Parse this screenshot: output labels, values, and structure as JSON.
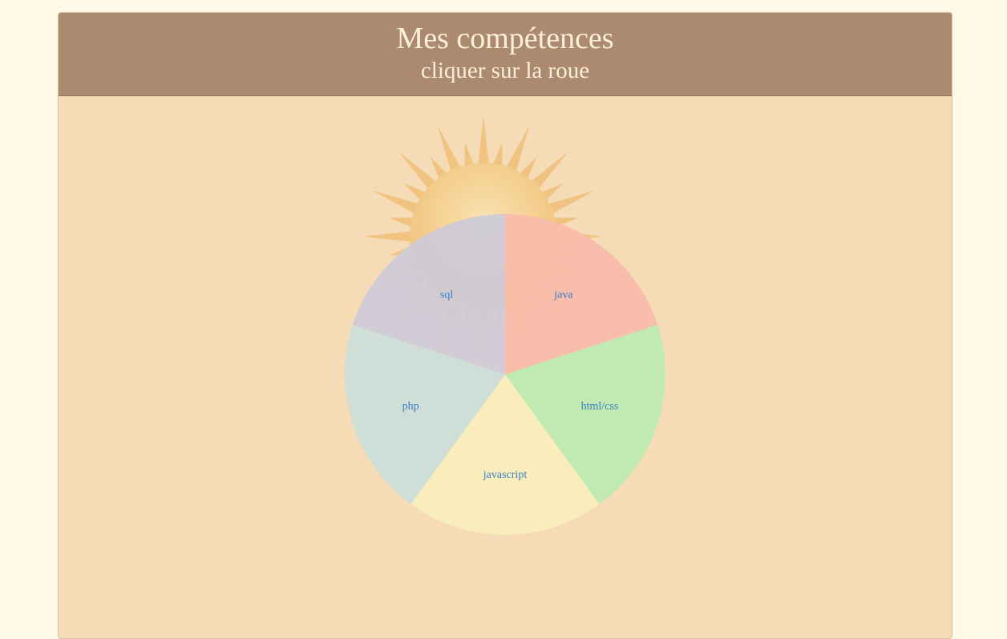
{
  "header": {
    "title": "Mes compétences",
    "subtitle": "cliquer sur la roue"
  },
  "wheel": {
    "label_color": "#3a7fc4",
    "sun_icon": "sun-icon",
    "slices": [
      {
        "label": "java",
        "color": "#f9bcaa"
      },
      {
        "label": "html/css",
        "color": "#bbecb2"
      },
      {
        "label": "javascript",
        "color": "#f9efbd"
      },
      {
        "label": "php",
        "color": "#cbe0da"
      },
      {
        "label": "sql",
        "color": "#cdcbd8"
      }
    ]
  }
}
